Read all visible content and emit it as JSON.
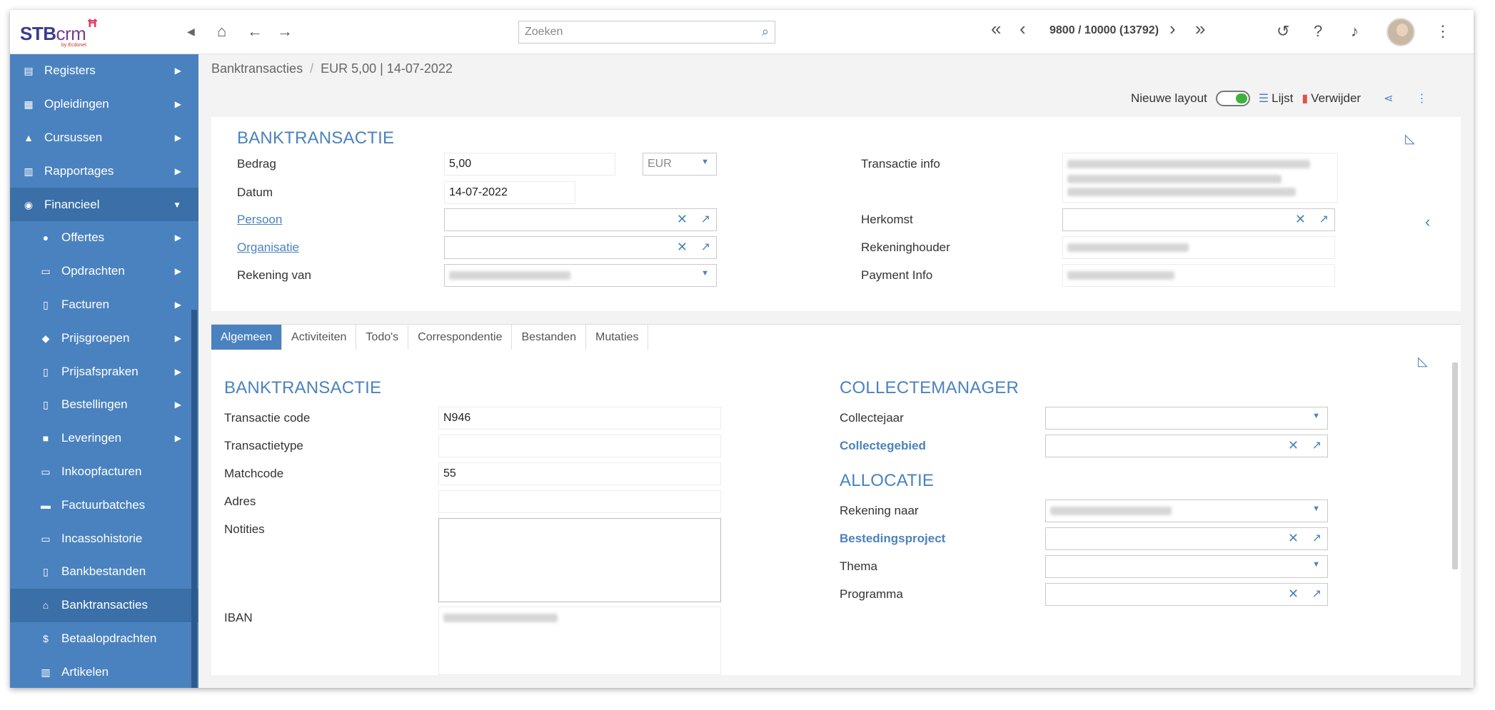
{
  "logo": {
    "brand": "STB",
    "crm": "crm",
    "sub": "by Ecdonet",
    "mark": "C8"
  },
  "sidebar": {
    "items": [
      {
        "label": "Registers",
        "icon": "book-icon"
      },
      {
        "label": "Opleidingen",
        "icon": "calendar-icon"
      },
      {
        "label": "Cursussen",
        "icon": "graduation-cap-icon"
      },
      {
        "label": "Rapportages",
        "icon": "report-icon"
      },
      {
        "label": "Financieel",
        "icon": "coins-icon"
      },
      {
        "label": "Offertes",
        "icon": "circle-icon"
      },
      {
        "label": "Opdrachten",
        "icon": "card-icon"
      },
      {
        "label": "Facturen",
        "icon": "file-icon"
      },
      {
        "label": "Prijsgroepen",
        "icon": "tags-icon"
      },
      {
        "label": "Prijsafspraken",
        "icon": "file-icon"
      },
      {
        "label": "Bestellingen",
        "icon": "file-dollar-icon"
      },
      {
        "label": "Leveringen",
        "icon": "truck-icon"
      },
      {
        "label": "Inkoopfacturen",
        "icon": "card-icon"
      },
      {
        "label": "Factuurbatches",
        "icon": "scroll-icon"
      },
      {
        "label": "Incassohistorie",
        "icon": "card-icon"
      },
      {
        "label": "Bankbestanden",
        "icon": "file-icon"
      },
      {
        "label": "Banktransacties",
        "icon": "bank-icon"
      },
      {
        "label": "Betaalopdrachten",
        "icon": "dollar-file-icon"
      },
      {
        "label": "Artikelen",
        "icon": "barcode-icon"
      }
    ]
  },
  "topbar": {
    "search_placeholder": "Zoeken",
    "pager": "9800 / 10000 (13792)"
  },
  "breadcrumb": {
    "root": "Banktransacties",
    "current": "EUR 5,00 | 14-07-2022"
  },
  "actions": {
    "new_layout": "Nieuwe layout",
    "list": "Lijst",
    "delete": "Verwijder"
  },
  "header_panel": {
    "title": "BANKTRANSACTIE",
    "bedrag_label": "Bedrag",
    "bedrag_value": "5,00",
    "currency": "EUR",
    "datum_label": "Datum",
    "datum_value": "14-07-2022",
    "persoon_label": "Persoon",
    "organisatie_label": "Organisatie",
    "rekening_van_label": "Rekening van",
    "transactie_info_label": "Transactie info",
    "herkomst_label": "Herkomst",
    "rekeninghouder_label": "Rekeninghouder",
    "payment_info_label": "Payment Info"
  },
  "tabs": [
    "Algemeen",
    "Activiteiten",
    "Todo's",
    "Correspondentie",
    "Bestanden",
    "Mutaties"
  ],
  "detail": {
    "title_left": "BANKTRANSACTIE",
    "transactie_code_label": "Transactie code",
    "transactie_code_value": "N946",
    "transactietype_label": "Transactietype",
    "matchcode_label": "Matchcode",
    "matchcode_value": "55",
    "adres_label": "Adres",
    "notities_label": "Notities",
    "iban_label": "IBAN",
    "title_collecte": "COLLECTEMANAGER",
    "collectejaar_label": "Collectejaar",
    "collectegebied_label": "Collectegebied",
    "title_allocatie": "ALLOCATIE",
    "rekening_naar_label": "Rekening naar",
    "bestedingsproject_label": "Bestedingsproject",
    "thema_label": "Thema",
    "programma_label": "Programma"
  },
  "colors": {
    "accent": "#4a82bf",
    "sidebar": "#4a82bf",
    "sidebar_active": "#3a6fa8",
    "toggle_on": "#3db33d",
    "delete": "#e05050"
  }
}
